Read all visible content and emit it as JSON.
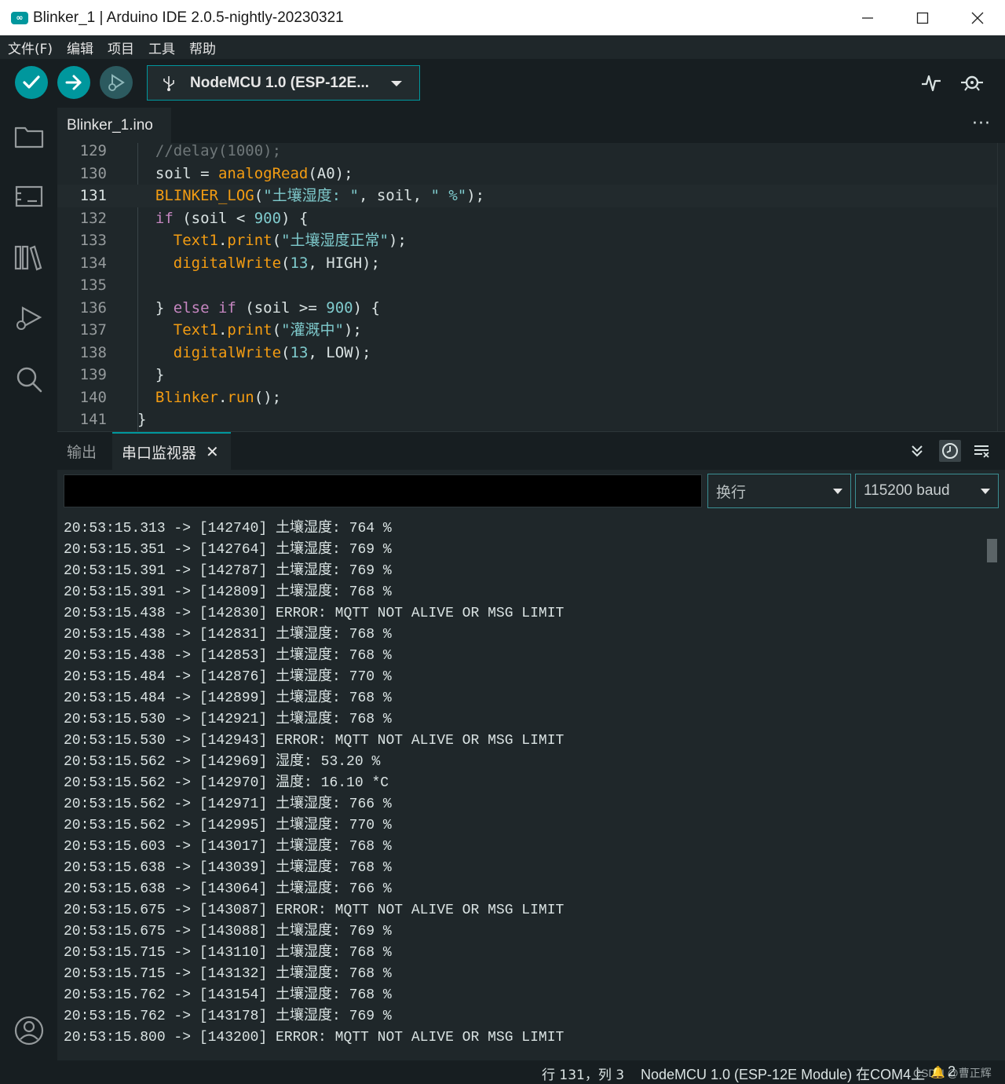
{
  "window": {
    "title": "Blinker_1 | Arduino IDE 2.0.5-nightly-20230321",
    "icon_text": "∞"
  },
  "menu": [
    "文件(F)",
    "编辑",
    "项目",
    "工具",
    "帮助"
  ],
  "toolbar": {
    "board": "NodeMCU 1.0 (ESP-12E..."
  },
  "editor": {
    "tab": "Blinker_1.ino",
    "more": "···",
    "active_line": 131,
    "lines": [
      {
        "n": "129",
        "html": "  <span class=\"cm\">//delay(1000);</span>"
      },
      {
        "n": "130",
        "html": "  <span class=\"pl\">soil = </span><span class=\"fn\">analogRead</span><span class=\"pl\">(A0);</span>"
      },
      {
        "n": "131",
        "html": "  <span class=\"fn\">BLINKER_LOG</span><span class=\"pl\">(</span><span class=\"st\">\"土壤湿度: \"</span><span class=\"pl\">, soil, </span><span class=\"st\">\" %\"</span><span class=\"pl\">);</span>"
      },
      {
        "n": "132",
        "html": "  <span class=\"kw\">if</span><span class=\"pl\"> (soil &lt; </span><span class=\"nm\">900</span><span class=\"pl\">) {</span>"
      },
      {
        "n": "133",
        "html": "    <span class=\"fn\">Text1</span><span class=\"pl\">.</span><span class=\"fn\">print</span><span class=\"pl\">(</span><span class=\"st\">\"土壤湿度正常\"</span><span class=\"pl\">);</span>"
      },
      {
        "n": "134",
        "html": "    <span class=\"fn\">digitalWrite</span><span class=\"pl\">(</span><span class=\"nm\">13</span><span class=\"pl\">, HIGH);</span>"
      },
      {
        "n": "135",
        "html": ""
      },
      {
        "n": "136",
        "html": "  <span class=\"pl\">} </span><span class=\"kw\">else if</span><span class=\"pl\"> (soil &gt;= </span><span class=\"nm\">900</span><span class=\"pl\">) {</span>"
      },
      {
        "n": "137",
        "html": "    <span class=\"fn\">Text1</span><span class=\"pl\">.</span><span class=\"fn\">print</span><span class=\"pl\">(</span><span class=\"st\">\"灌溉中\"</span><span class=\"pl\">);</span>"
      },
      {
        "n": "138",
        "html": "    <span class=\"fn\">digitalWrite</span><span class=\"pl\">(</span><span class=\"nm\">13</span><span class=\"pl\">, LOW);</span>"
      },
      {
        "n": "139",
        "html": "  <span class=\"pl\">}</span>"
      },
      {
        "n": "140",
        "html": "  <span class=\"fn\">Blinker</span><span class=\"pl\">.</span><span class=\"fn\">run</span><span class=\"pl\">();</span>"
      },
      {
        "n": "141",
        "html": "<span class=\"pl\">}</span>"
      }
    ]
  },
  "panel": {
    "tab_output": "输出",
    "tab_serial": "串口监视器",
    "close": "✕",
    "line_ending": "换行",
    "baud": "115200 baud",
    "log": [
      "20:53:15.313 -> [142740] 土壤湿度: 764 %",
      "20:53:15.351 -> [142764] 土壤湿度: 769 %",
      "20:53:15.391 -> [142787] 土壤湿度: 769 %",
      "20:53:15.391 -> [142809] 土壤湿度: 768 %",
      "20:53:15.438 -> [142830] ERROR: MQTT NOT ALIVE OR MSG LIMIT",
      "20:53:15.438 -> [142831] 土壤湿度: 768 %",
      "20:53:15.438 -> [142853] 土壤湿度: 768 %",
      "20:53:15.484 -> [142876] 土壤湿度: 770 %",
      "20:53:15.484 -> [142899] 土壤湿度: 768 %",
      "20:53:15.530 -> [142921] 土壤湿度: 768 %",
      "20:53:15.530 -> [142943] ERROR: MQTT NOT ALIVE OR MSG LIMIT",
      "20:53:15.562 -> [142969] 湿度: 53.20 %",
      "20:53:15.562 -> [142970] 温度: 16.10 *C",
      "20:53:15.562 -> [142971] 土壤湿度: 766 %",
      "20:53:15.562 -> [142995] 土壤湿度: 770 %",
      "20:53:15.603 -> [143017] 土壤湿度: 768 %",
      "20:53:15.638 -> [143039] 土壤湿度: 768 %",
      "20:53:15.638 -> [143064] 土壤湿度: 766 %",
      "20:53:15.675 -> [143087] ERROR: MQTT NOT ALIVE OR MSG LIMIT",
      "20:53:15.675 -> [143088] 土壤湿度: 769 %",
      "20:53:15.715 -> [143110] 土壤湿度: 768 %",
      "20:53:15.715 -> [143132] 土壤湿度: 768 %",
      "20:53:15.762 -> [143154] 土壤湿度: 768 %",
      "20:53:15.762 -> [143178] 土壤湿度: 769 %",
      "20:53:15.800 -> [143200] ERROR: MQTT NOT ALIVE OR MSG LIMIT"
    ]
  },
  "status": {
    "position": "行 131，列 3",
    "board": "NodeMCU 1.0 (ESP-12E Module) 在COM4上",
    "watermark": "CSDN @曹正辉",
    "count": "2"
  },
  "colors": {
    "accent": "#00979d",
    "background": "#171e21",
    "editor_bg": "#1f272a"
  }
}
